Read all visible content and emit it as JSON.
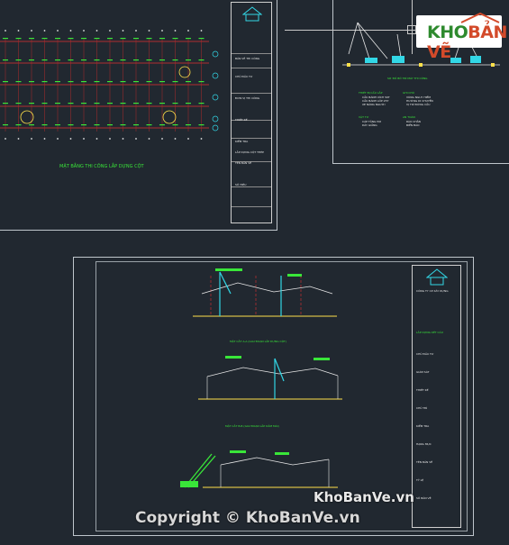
{
  "viewport": {
    "background": "#212830",
    "accent_green": "#39e639",
    "accent_yellow": "#ffe14a",
    "accent_red": "#e03030",
    "accent_cyan": "#32d7e6"
  },
  "sheet_plan": {
    "caption": "MẶT BẰNG THI CÔNG LẮP DỰNG CỘT",
    "title_block": {
      "section_label": "BẢN VẼ THI CÔNG",
      "drawing_title": "LẮP DỰNG CỘT THÉP",
      "rows": [
        "CHỦ ĐẦU TƯ",
        "ĐƠN VỊ THI CÔNG",
        "THIẾT KẾ",
        "KIỂM TRA",
        "TÊN BẢN VẼ",
        "SỐ HIỆU"
      ]
    }
  },
  "sheet_crane": {
    "caption": "SƠ ĐỒ BỐ TRÍ MÁY THI CÔNG",
    "legend_groups": [
      {
        "title": "THIẾT BỊ CẨU LẮP",
        "items": [
          "CẨU BÁNH XÍCH 50T",
          "CẨU BÁNH LỐP 25T",
          "XE NÂNG NGƯỜI"
        ]
      },
      {
        "title": "GHI CHÚ",
        "items": [
          "VÙNG NGUY HIỂM",
          "HƯỚNG DI CHUYỂN",
          "VỊ TRÍ ĐỨNG CẨU"
        ]
      },
      {
        "title": "VẬT TƯ",
        "items": [
          "CÁP TĂNG ĐƠ",
          "DÂY GIẰNG"
        ]
      },
      {
        "title": "AN TOÀN",
        "items": [
          "RÀO CHẮN",
          "BIỂN BÁO"
        ]
      }
    ]
  },
  "sheet_sections": {
    "captions": [
      "MẶT CẮT A-A (GIAI ĐOẠN LẮP DỰNG CỘT)",
      "MẶT CẮT B-B (GIAI ĐOẠN LẮP DẦM MÁI)",
      "MẶT CẮT C-C (GIAI ĐOẠN LẮP XÀ GỒ)"
    ],
    "title_block": {
      "company": "CÔNG TY CP XÂY DỰNG",
      "drawing_title": "LẮP DỰNG KẾT CẤU",
      "rows": [
        "CHỦ ĐẦU TƯ",
        "GIÁM SÁT",
        "THIẾT KẾ",
        "CHỦ TRÌ",
        "KIỂM TRA",
        "HẠNG MỤC",
        "TÊN BẢN VẼ",
        "TỶ LỆ",
        "SỐ BẢN VẼ"
      ]
    }
  },
  "logo": {
    "part1": "KHO",
    "part2": "BẢN VẼ"
  },
  "watermarks": {
    "site": "KhoBanVe.vn",
    "copyright": "Copyright © KhoBanVe.vn"
  }
}
